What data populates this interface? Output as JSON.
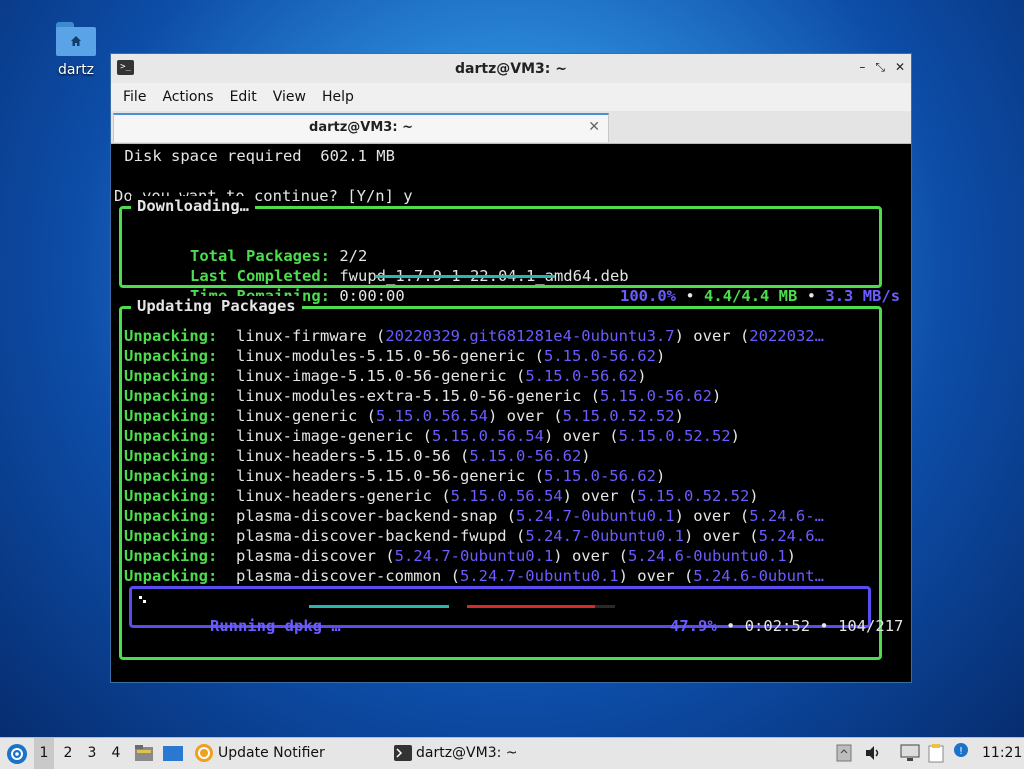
{
  "desktop": {
    "home_icon_label": "dartz"
  },
  "window": {
    "title": "dartz@VM3: ~",
    "controls": [
      "–",
      "⤡",
      "✕"
    ],
    "menu": [
      "File",
      "Actions",
      "Edit",
      "View",
      "Help"
    ],
    "tab": {
      "label": "dartz@VM3: ~",
      "close": "✕"
    }
  },
  "terminal": {
    "disk_line": " Disk space required  602.1 MB",
    "prompt_line": "Do you want to continue? [Y/n] y",
    "downloading": {
      "title": "Downloading…",
      "total_label": "Total Packages:",
      "total_value": "2/2",
      "last_label": "Last Completed:",
      "last_value": "fwupd_1.7.9-1~22.04.1_amd64.deb",
      "remaining_label": "Time Remaining:",
      "remaining_value": "0:00:00",
      "percent": "100.0%",
      "size": "4.4/4.4 MB",
      "speed": "3.3 MB/s",
      "progress": 1.0
    },
    "updating": {
      "title": "Updating Packages",
      "action_label": "Unpacking:",
      "rows": [
        {
          "pkg": "linux-firmware ",
          "v1": "20220329.git681281e4-0ubuntu3.7",
          "mid": ") over (",
          "v2": "2022032…",
          "end": ""
        },
        {
          "pkg": "linux-modules-5.15.0-56-generic ",
          "v1": "5.15.0-56.62",
          "mid": "",
          "v2": "",
          "end": ")"
        },
        {
          "pkg": "linux-image-5.15.0-56-generic ",
          "v1": "5.15.0-56.62",
          "mid": "",
          "v2": "",
          "end": ")"
        },
        {
          "pkg": "linux-modules-extra-5.15.0-56-generic ",
          "v1": "5.15.0-56.62",
          "mid": "",
          "v2": "",
          "end": ")"
        },
        {
          "pkg": "linux-generic ",
          "v1": "5.15.0.56.54",
          "mid": ") over (",
          "v2": "5.15.0.52.52",
          "end": ")"
        },
        {
          "pkg": "linux-image-generic ",
          "v1": "5.15.0.56.54",
          "mid": ") over (",
          "v2": "5.15.0.52.52",
          "end": ")"
        },
        {
          "pkg": "linux-headers-5.15.0-56 ",
          "v1": "5.15.0-56.62",
          "mid": "",
          "v2": "",
          "end": ")"
        },
        {
          "pkg": "linux-headers-5.15.0-56-generic ",
          "v1": "5.15.0-56.62",
          "mid": "",
          "v2": "",
          "end": ")"
        },
        {
          "pkg": "linux-headers-generic ",
          "v1": "5.15.0.56.54",
          "mid": ") over (",
          "v2": "5.15.0.52.52",
          "end": ")"
        },
        {
          "pkg": "plasma-discover-backend-snap ",
          "v1": "5.24.7-0ubuntu0.1",
          "mid": ") over (",
          "v2": "5.24.6-…",
          "end": ""
        },
        {
          "pkg": "plasma-discover-backend-fwupd ",
          "v1": "5.24.7-0ubuntu0.1",
          "mid": ") over (",
          "v2": "5.24.6…",
          "end": ""
        },
        {
          "pkg": "plasma-discover ",
          "v1": "5.24.7-0ubuntu0.1",
          "mid": ") over (",
          "v2": "5.24.6-0ubuntu0.1",
          "end": ")"
        },
        {
          "pkg": "plasma-discover-common ",
          "v1": "5.24.7-0ubuntu0.1",
          "mid": ") over (",
          "v2": "5.24.6-0ubunt…",
          "end": ""
        }
      ],
      "dpkg": {
        "label": "Running dpkg …",
        "percent": "47.9%",
        "elapsed": "0:02:52",
        "count": "104/217",
        "progress": 0.479
      }
    },
    "separator": "•"
  },
  "taskbar": {
    "workspaces": [
      "1",
      "2",
      "3",
      "4"
    ],
    "active_workspace": "1",
    "tasks": [
      {
        "label": "Update Notifier",
        "icon": "update-notifier-icon"
      },
      {
        "label": "dartz@VM3: ~",
        "icon": "terminal-icon"
      }
    ],
    "clock": "11:21"
  },
  "colors": {
    "green": "#4ddc4d",
    "blue": "#6a5cff",
    "accent": "#4a90d9"
  }
}
